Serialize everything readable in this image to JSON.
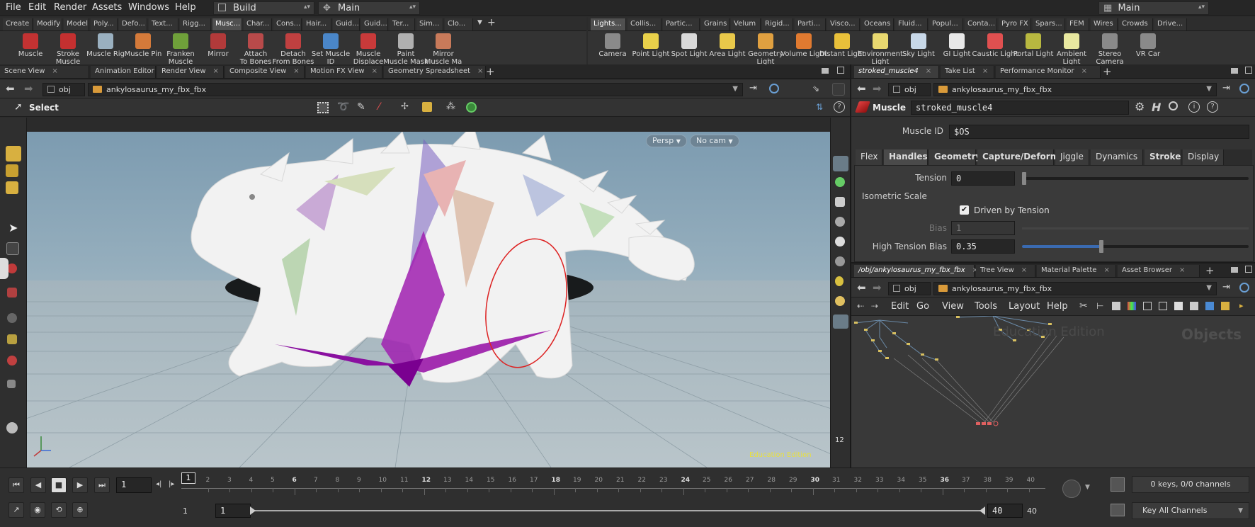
{
  "menubar": {
    "items": [
      "File",
      "Edit",
      "Render",
      "Assets",
      "Windows",
      "Help"
    ],
    "desktop_left": "Build",
    "desktop_mid": "Main",
    "desktop_right": "Main"
  },
  "shelf_tabs_left": [
    "Create",
    "Modify",
    "Model",
    "Poly...",
    "Defo...",
    "Text...",
    "Rigg...",
    "Musc...",
    "Char...",
    "Cons...",
    "Hair...",
    "Guid...",
    "Guid...",
    "Ter...",
    "Sim...",
    "Clo..."
  ],
  "shelf_tabs_right": [
    "Lights...",
    "Collis...",
    "Partic...",
    "Grains",
    "Velum",
    "Rigid...",
    "Parti...",
    "Visco...",
    "Oceans",
    "Fluid...",
    "Popul...",
    "Conta...",
    "Pyro FX",
    "Spars...",
    "FEM",
    "Wires",
    "Crowds",
    "Drive..."
  ],
  "shelf_tools_left": [
    {
      "l1": "Muscle",
      "l2": "",
      "color": "#c23232"
    },
    {
      "l1": "Stroke Muscle",
      "l2": "",
      "color": "#c43030"
    },
    {
      "l1": "Muscle Rig",
      "l2": "",
      "color": "#9ab0c0"
    },
    {
      "l1": "Muscle Pin",
      "l2": "",
      "color": "#d47a3a"
    },
    {
      "l1": "Franken",
      "l2": "Muscle",
      "color": "#6fa03a"
    },
    {
      "l1": "Mirror",
      "l2": "",
      "color": "#b23a3a"
    },
    {
      "l1": "Attach",
      "l2": "To Bones",
      "color": "#b84a4a"
    },
    {
      "l1": "Detach",
      "l2": "From Bones",
      "color": "#c04040"
    },
    {
      "l1": "Set Muscle ID",
      "l2": "",
      "color": "#4a86c8"
    },
    {
      "l1": "Muscle",
      "l2": "Displace",
      "color": "#c83a3a"
    },
    {
      "l1": "Paint",
      "l2": "Muscle Mask",
      "color": "#b0b0b0"
    },
    {
      "l1": "Mirror",
      "l2": "Muscle Ma",
      "color": "#c87a5a"
    }
  ],
  "shelf_tools_right": [
    {
      "l1": "Camera",
      "l2": "",
      "color": "#8a8a8a"
    },
    {
      "l1": "Point Light",
      "l2": "",
      "color": "#e8d04a"
    },
    {
      "l1": "Spot Light",
      "l2": "",
      "color": "#d8d8d8"
    },
    {
      "l1": "Area Light",
      "l2": "",
      "color": "#e8c84a"
    },
    {
      "l1": "Geometry",
      "l2": "Light",
      "color": "#e0a040"
    },
    {
      "l1": "Volume Light",
      "l2": "",
      "color": "#e07a30"
    },
    {
      "l1": "Distant Light",
      "l2": "",
      "color": "#e8c03a"
    },
    {
      "l1": "Environment",
      "l2": "Light",
      "color": "#e8d870"
    },
    {
      "l1": "Sky Light",
      "l2": "",
      "color": "#c8d8e8"
    },
    {
      "l1": "GI Light",
      "l2": "",
      "color": "#e8e8e8"
    },
    {
      "l1": "Caustic Light",
      "l2": "",
      "color": "#e05050"
    },
    {
      "l1": "Portal Light",
      "l2": "",
      "color": "#b8b840"
    },
    {
      "l1": "Ambient Light",
      "l2": "",
      "color": "#e8e8a0"
    },
    {
      "l1": "Stereo",
      "l2": "Camera",
      "color": "#8a8a8a"
    },
    {
      "l1": "VR Car",
      "l2": "",
      "color": "#8a8a8a"
    }
  ],
  "left_pane_tabs": [
    "Scene View",
    "Animation Editor",
    "Render View",
    "Composite View",
    "Motion FX View",
    "Geometry Spreadsheet"
  ],
  "left_path": {
    "root": "obj",
    "node": "ankylosaurus_my_fbx_fbx"
  },
  "viewport": {
    "select_label": "Select",
    "persp": "Persp",
    "cam": "No cam",
    "watermark": "Education Edition",
    "side_number": "12"
  },
  "param_pane_tabs": [
    "stroked_muscle4",
    "Take List",
    "Performance Monitor"
  ],
  "param_path": {
    "root": "obj",
    "node": "ankylosaurus_my_fbx_fbx"
  },
  "params": {
    "node_type": "Muscle",
    "node_name": "stroked_muscle4",
    "muscle_id_label": "Muscle ID",
    "muscle_id_value": "$OS",
    "tabs": [
      "Flex",
      "Handles",
      "Geometry",
      "Capture/Deform",
      "Jiggle",
      "Dynamics",
      "Stroke",
      "Display"
    ],
    "tension_label": "Tension",
    "tension_value": "0",
    "tension_fraction": 0.0,
    "isometric_label": "Isometric Scale",
    "driven_label": "Driven by Tension",
    "bias_label": "Bias",
    "bias_value": "1",
    "high_bias_label": "High Tension Bias",
    "high_bias_value": "0.35",
    "high_bias_fraction": 0.35
  },
  "network_pane_tabs": [
    "/obj/ankylosaurus_my_fbx_fbx",
    "Tree View",
    "Material Palette",
    "Asset Browser"
  ],
  "network_path": {
    "root": "obj",
    "node": "ankylosaurus_my_fbx_fbx"
  },
  "network_menu": [
    "Edit",
    "Go",
    "View",
    "Tools",
    "Layout",
    "Help"
  ],
  "network_watermark": "Education Edition",
  "network_context": "Objects",
  "timeline": {
    "current_frame": "1",
    "frame_marker": "1",
    "ticks": [
      "2",
      "3",
      "4",
      "5",
      "6",
      "7",
      "8",
      "9",
      "10",
      "11",
      "12",
      "13",
      "14",
      "15",
      "16",
      "17",
      "18",
      "19",
      "20",
      "21",
      "22",
      "23",
      "24",
      "25",
      "26",
      "27",
      "28",
      "29",
      "30",
      "31",
      "32",
      "33",
      "34",
      "35",
      "36",
      "37",
      "38",
      "39",
      "40"
    ],
    "start": "1",
    "range_start": "1",
    "range_end": "40",
    "end": "40",
    "keys_info": "0 keys, 0/0 channels",
    "key_mode": "Key All Channels"
  }
}
